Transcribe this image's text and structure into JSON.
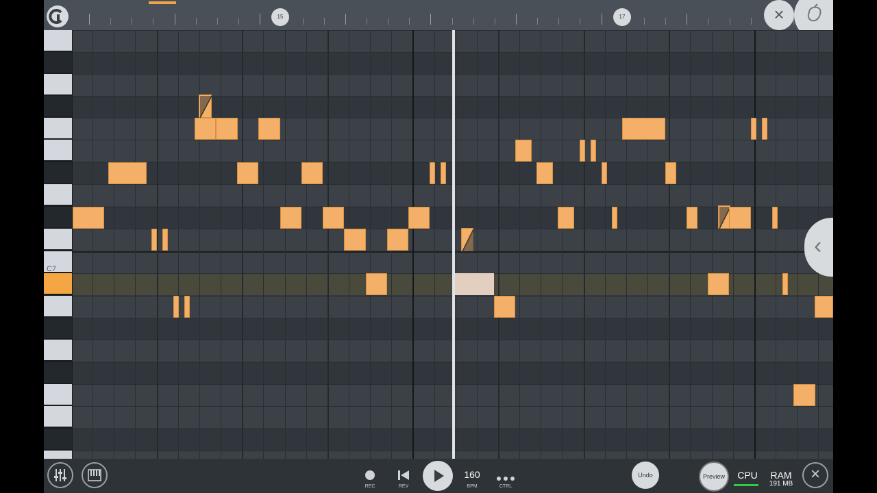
{
  "timeline": {
    "bar_markers": [
      "15",
      "17"
    ]
  },
  "keyboard": {
    "octave_label": "C7"
  },
  "transport": {
    "rec_label": "REC",
    "rev_label": "REV",
    "bpm_value": "160",
    "bpm_label": "BPM",
    "ctrl_label": "CTRL"
  },
  "right_controls": {
    "undo_label": "Undo",
    "preview_label": "Preview",
    "cpu_label": "CPU",
    "ram_label": "RAM",
    "ram_value": "191 MB"
  },
  "icons": {
    "logo": "app-logo-icon",
    "close": "close-icon",
    "fruit": "fruit-logo-icon",
    "mixer": "mixer-icon",
    "piano": "piano-icon",
    "back": "chevron-left-icon"
  },
  "colors": {
    "note": "#f4b068",
    "selected_key": "#f3a642",
    "cpu_meter": "#2ecc40"
  }
}
